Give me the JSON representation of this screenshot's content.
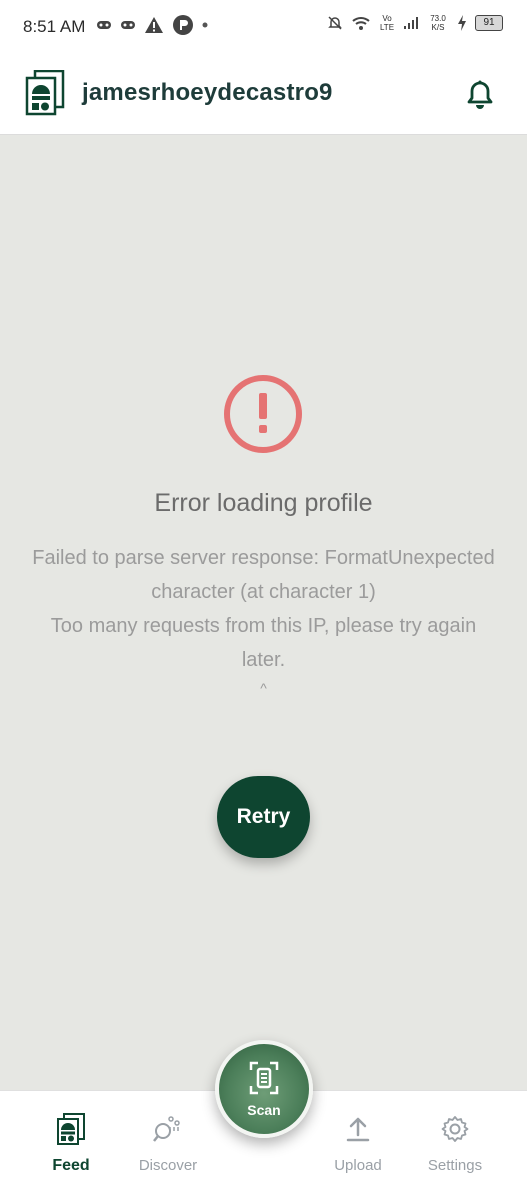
{
  "status_bar": {
    "time": "8:51 AM",
    "network_type": "Vo LTE",
    "net_speed": "73.0 K/S",
    "battery": "91"
  },
  "app_bar": {
    "username": "jamesrhoeydecastro9",
    "logo_icon": "app-logo-icon",
    "notification_icon": "bell-icon"
  },
  "error": {
    "icon": "error-circle-icon",
    "title": "Error loading profile",
    "message_lines": [
      "Failed to parse server response: FormatUnexpected",
      "character (at character 1)",
      "Too many requests from this IP, please try again",
      "later."
    ],
    "caret": "^",
    "retry_label": "Retry"
  },
  "bottom_nav": {
    "items": [
      {
        "label": "Feed",
        "icon": "feed-icon",
        "active": true
      },
      {
        "label": "Discover",
        "icon": "discover-icon",
        "active": false
      },
      {
        "label": "Upload",
        "icon": "upload-icon",
        "active": false
      },
      {
        "label": "Settings",
        "icon": "gear-icon",
        "active": false
      }
    ],
    "scan": {
      "label": "Scan",
      "icon": "scan-icon"
    }
  },
  "colors": {
    "brand_dark": "#0e4530",
    "error_red": "#e57373",
    "background": "#e6e7e3"
  }
}
